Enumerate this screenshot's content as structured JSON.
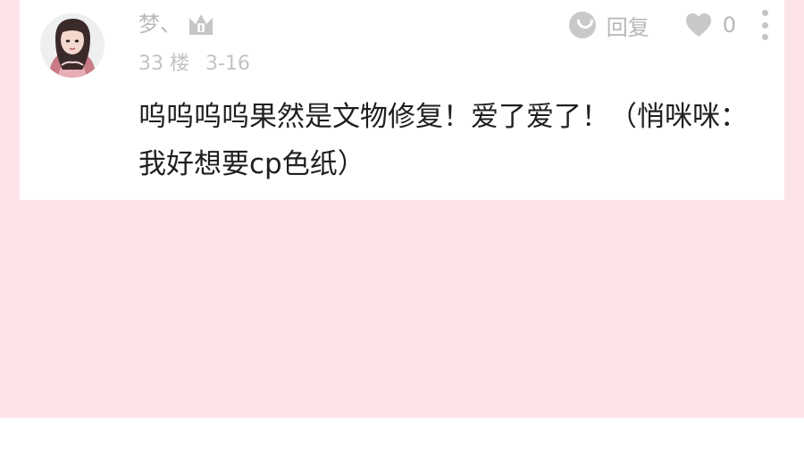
{
  "comment": {
    "username": "梦、",
    "floor": "33 楼",
    "date": "3-16",
    "text": "呜呜呜呜果然是文物修复！爱了爱了！（悄咪咪：我好想要cp色纸）",
    "reply_label": "回复",
    "like_count": "0"
  },
  "icons": {
    "avatar": "avatar-portrait",
    "badge": "crown-icon",
    "reply": "reply-icon",
    "like": "heart-icon",
    "more": "more-vertical-icon"
  },
  "colors": {
    "background_pink": "#fde4e8",
    "card": "#ffffff",
    "text_primary": "#1f1f1f",
    "text_secondary": "#b9b9b9"
  }
}
